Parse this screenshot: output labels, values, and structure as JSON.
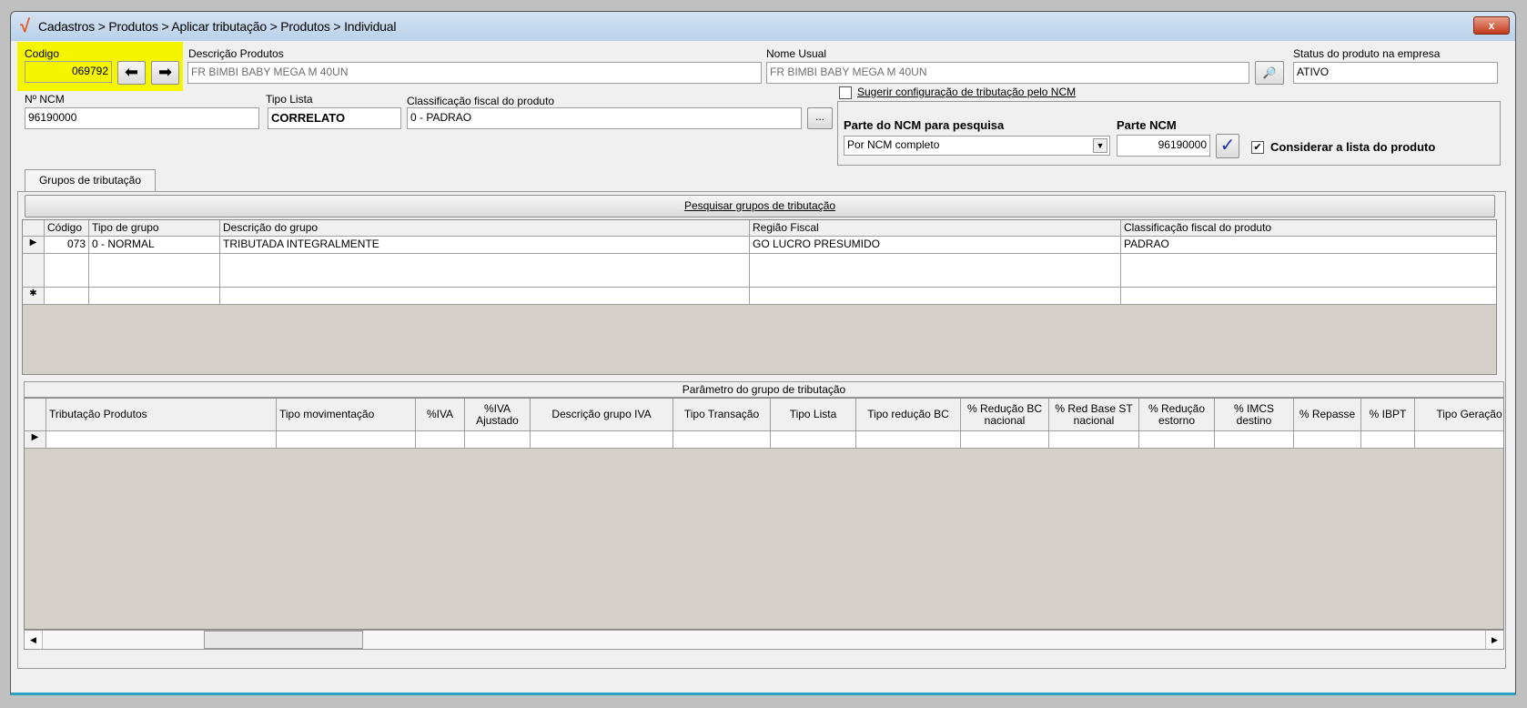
{
  "window": {
    "title": "Cadastros > Produtos > Aplicar tributação > Produtos > Individual",
    "close": "x"
  },
  "form": {
    "codigo_label": "Codigo",
    "codigo": "069792",
    "descricao_label": "Descrição  Produtos",
    "descricao": "FR BIMBI BABY MEGA M 40UN",
    "nome_usual_label": "Nome Usual",
    "nome_usual": "FR BIMBI BABY MEGA M 40UN",
    "status_label": "Status do produto na empresa",
    "status": "ATIVO",
    "ncm_label": "Nº NCM",
    "ncm": "96190000",
    "tipo_lista_label": "Tipo Lista",
    "tipo_lista": "CORRELATO",
    "classificacao_label": "Classificação fiscal do produto",
    "classificacao": "0 - PADRAO",
    "ellipsis": "...",
    "sugerir_label": "Sugerir configuração de tributação pelo NCM",
    "parte_ncm_pesquisa_label": "Parte do NCM para pesquisa",
    "parte_ncm_pesquisa": "Por NCM completo",
    "parte_ncm_label": "Parte NCM",
    "parte_ncm": "96190000",
    "considerar_label": "Considerar a lista do produto"
  },
  "tab": {
    "label": "Grupos de tributação"
  },
  "grid1": {
    "search_button": "Pesquisar grupos de tributação",
    "columns": [
      "Código",
      "Tipo de grupo",
      "Descrição do grupo",
      "Região Fiscal",
      "Classificação fiscal do produto"
    ],
    "rows": [
      [
        "073",
        "0 - NORMAL",
        "TRIBUTADA INTEGRALMENTE",
        "GO LUCRO PRESUMIDO",
        "PADRAO"
      ]
    ]
  },
  "grid2": {
    "caption": "Parâmetro do grupo de tributação",
    "columns": [
      "Tributação Produtos",
      "Tipo movimentação",
      "%IVA",
      "%IVA Ajustado",
      "Descrição grupo IVA",
      "Tipo Transação",
      "Tipo Lista",
      "Tipo redução BC",
      "% Redução BC nacional",
      "% Red Base ST nacional",
      "% Redução estorno",
      "% IMCS destino",
      "% Repasse",
      "% IBPT",
      "Tipo Geração D"
    ]
  }
}
